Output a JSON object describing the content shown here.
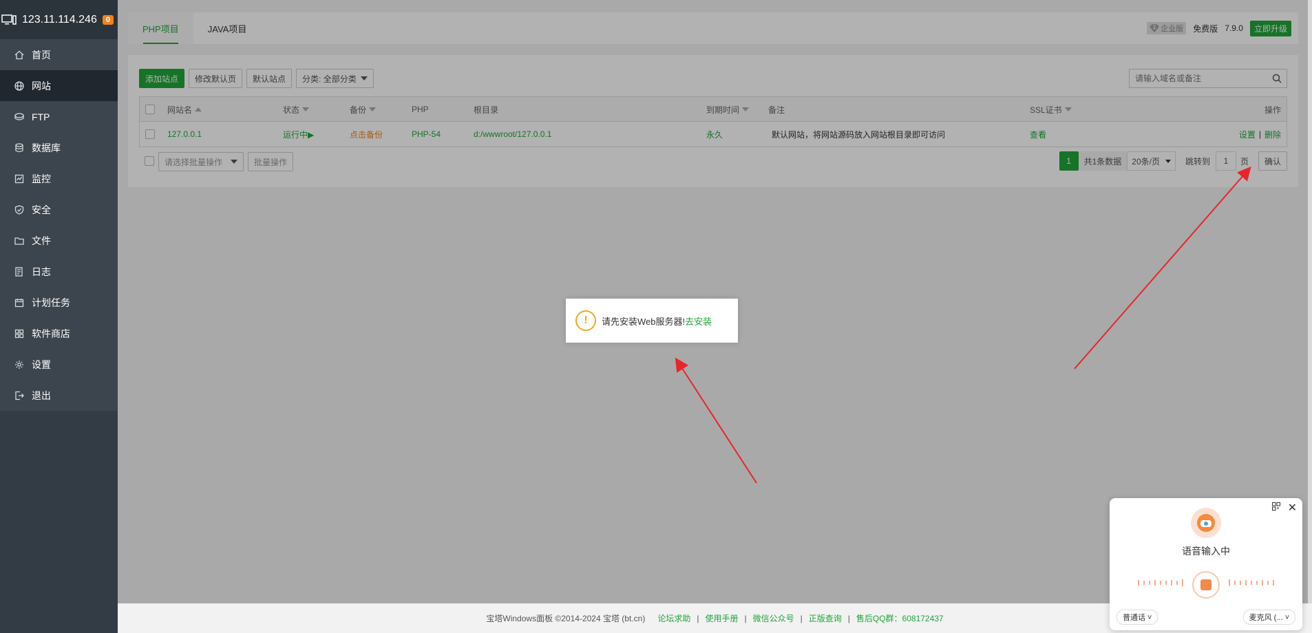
{
  "server": {
    "ip": "123.11.114.246",
    "badge": "0"
  },
  "sidebar": {
    "items": [
      {
        "label": "首页",
        "icon": "home-icon"
      },
      {
        "label": "网站",
        "icon": "globe-icon",
        "active": true
      },
      {
        "label": "FTP",
        "icon": "ftp-icon"
      },
      {
        "label": "数据库",
        "icon": "database-icon"
      },
      {
        "label": "监控",
        "icon": "monitor-icon"
      },
      {
        "label": "安全",
        "icon": "shield-icon"
      },
      {
        "label": "文件",
        "icon": "folder-icon"
      },
      {
        "label": "日志",
        "icon": "log-icon"
      },
      {
        "label": "计划任务",
        "icon": "calendar-icon"
      },
      {
        "label": "软件商店",
        "icon": "apps-icon"
      },
      {
        "label": "设置",
        "icon": "gear-icon"
      },
      {
        "label": "退出",
        "icon": "logout-icon"
      }
    ]
  },
  "tabs": [
    {
      "label": "PHP项目",
      "active": true
    },
    {
      "label": "JAVA项目"
    }
  ],
  "header_right": {
    "enterprise": "企业版",
    "edition": "免费版",
    "version": "7.9.0",
    "upgrade": "立即升级"
  },
  "toolbar": {
    "add_site": "添加站点",
    "edit_default": "修改默认页",
    "default_site": "默认站点",
    "category": "分类: 全部分类",
    "search_placeholder": "请输入域名或备注"
  },
  "table": {
    "headers": {
      "name": "网站名",
      "status": "状态",
      "backup": "备份",
      "php": "PHP",
      "root": "根目录",
      "expire": "到期时间",
      "remark": "备注",
      "ssl": "SSL证书",
      "ops": "操作"
    },
    "rows": [
      {
        "name": "127.0.0.1",
        "status": "运行中▶",
        "backup": "点击备份",
        "php": "PHP-54",
        "root": "d:/wwwroot/127.0.0.1",
        "expire": "永久",
        "remark": "默认网站，将网站源码放入网站根目录即可访问",
        "ssl": "查看",
        "op_settings": "设置",
        "op_sep": "|",
        "op_delete": "删除"
      }
    ]
  },
  "batch": {
    "select_placeholder": "请选择批量操作",
    "button": "批量操作"
  },
  "pager": {
    "current": "1",
    "total_text": "共1条数据",
    "per_page": "20条/页",
    "jump_label": "跳转到",
    "jump_value": "1",
    "page_unit": "页",
    "confirm": "确认"
  },
  "message": {
    "text": "请先安装Web服务器!",
    "link": "去安装"
  },
  "footer": {
    "copyright": "宝塔Windows面板 ©2014-2024 宝塔 (bt.cn)",
    "links": [
      "论坛求助",
      "使用手册",
      "微信公众号",
      "正版查询",
      "售后QQ群：608172437"
    ]
  },
  "voice_widget": {
    "title": "语音输入中",
    "language": "普通话",
    "mic": "麦克风 (..."
  },
  "colors": {
    "accent": "#20a53a",
    "sidebar_bg": "#333c44",
    "warning": "#f0831d",
    "arrow": "#e8252b"
  }
}
